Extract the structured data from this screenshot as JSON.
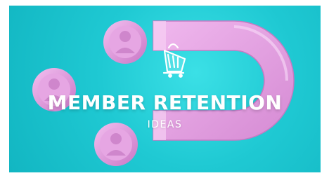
{
  "banner": {
    "title": "MEMBER RETENTION",
    "subtitle": "IDEAS",
    "logo_icon": "shopping-cart-icon",
    "colors": {
      "background": "#1fc9d3",
      "magnet": "#e8a9e6",
      "avatar_ring": "#d98bd6",
      "text": "#ffffff"
    }
  }
}
